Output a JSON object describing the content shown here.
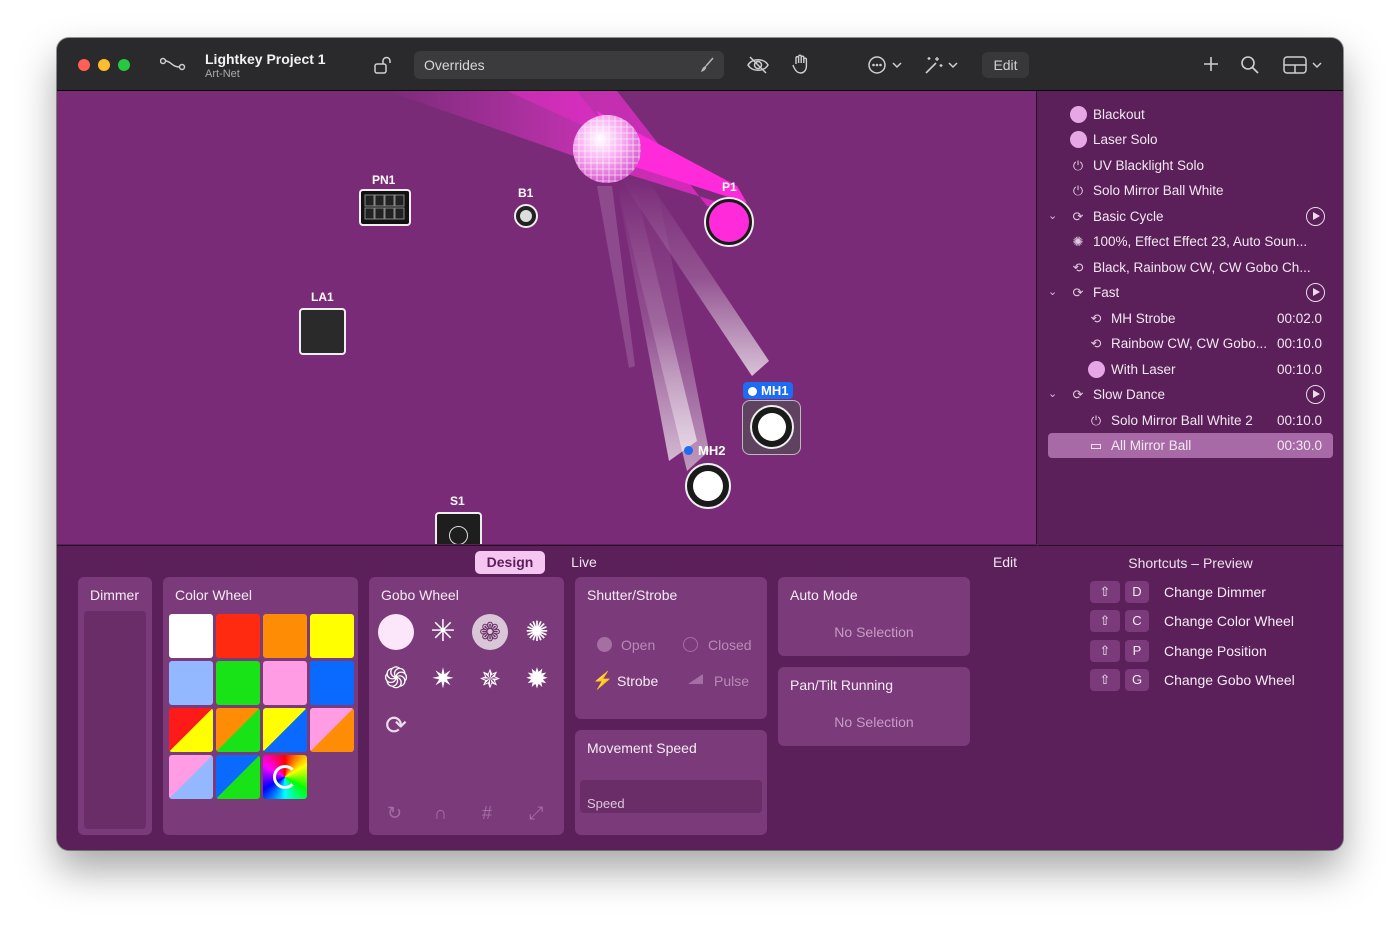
{
  "titlebar": {
    "project_name": "Lightkey Project 1",
    "project_sub": "Art-Net",
    "overrides_label": "Overrides",
    "edit_label": "Edit"
  },
  "stage": {
    "fixtures": {
      "pn1": "PN1",
      "b1": "B1",
      "p1": "P1",
      "la1": "LA1",
      "mh1": "MH1",
      "mh2": "MH2",
      "s1": "S1"
    }
  },
  "cuelist": {
    "rows": [
      {
        "label": "Blackout",
        "time": ""
      },
      {
        "label": "Laser Solo",
        "time": ""
      },
      {
        "label": "UV Blacklight Solo",
        "time": ""
      },
      {
        "label": "Solo Mirror Ball White",
        "time": ""
      },
      {
        "label": "Basic Cycle",
        "time": ""
      },
      {
        "label": "100%, Effect Effect 23, Auto Soun...",
        "time": ""
      },
      {
        "label": "Black, Rainbow CW, CW Gobo Ch...",
        "time": ""
      },
      {
        "label": "Fast",
        "time": ""
      },
      {
        "label": "MH Strobe",
        "time": "00:02.0"
      },
      {
        "label": "Rainbow CW, CW Gobo...",
        "time": "00:10.0"
      },
      {
        "label": "With Laser",
        "time": "00:10.0"
      },
      {
        "label": "Slow Dance",
        "time": ""
      },
      {
        "label": "Solo Mirror Ball White 2",
        "time": "00:10.0"
      },
      {
        "label": "All Mirror Ball",
        "time": "00:30.0"
      }
    ]
  },
  "bottom": {
    "tabs": {
      "design": "Design",
      "live": "Live"
    },
    "edit_label": "Edit",
    "dimmer_title": "Dimmer",
    "color_wheel_title": "Color Wheel",
    "gobo_wheel_title": "Gobo Wheel",
    "shutter_title": "Shutter/Strobe",
    "shutter_open": "Open",
    "shutter_closed": "Closed",
    "shutter_strobe": "Strobe",
    "shutter_pulse": "Pulse",
    "movement_title": "Movement Speed",
    "speed_label": "Speed",
    "auto_mode_title": "Auto Mode",
    "auto_mode_value": "No Selection",
    "pantilt_title": "Pan/Tilt Running",
    "pantilt_value": "No Selection"
  },
  "shortcuts": {
    "title": "Shortcuts – Preview",
    "items": [
      {
        "key": "D",
        "label": "Change Dimmer"
      },
      {
        "key": "C",
        "label": "Change Color Wheel"
      },
      {
        "key": "P",
        "label": "Change Position"
      },
      {
        "key": "G",
        "label": "Change Gobo Wheel"
      }
    ]
  },
  "colors": {
    "stage_bg": "#7a2b78",
    "panel_bg": "#5b1f59",
    "accent_pink": "#f6c6f2",
    "laser_magenta": "#ff2ad9",
    "selection_blue": "#1d6cf2"
  }
}
